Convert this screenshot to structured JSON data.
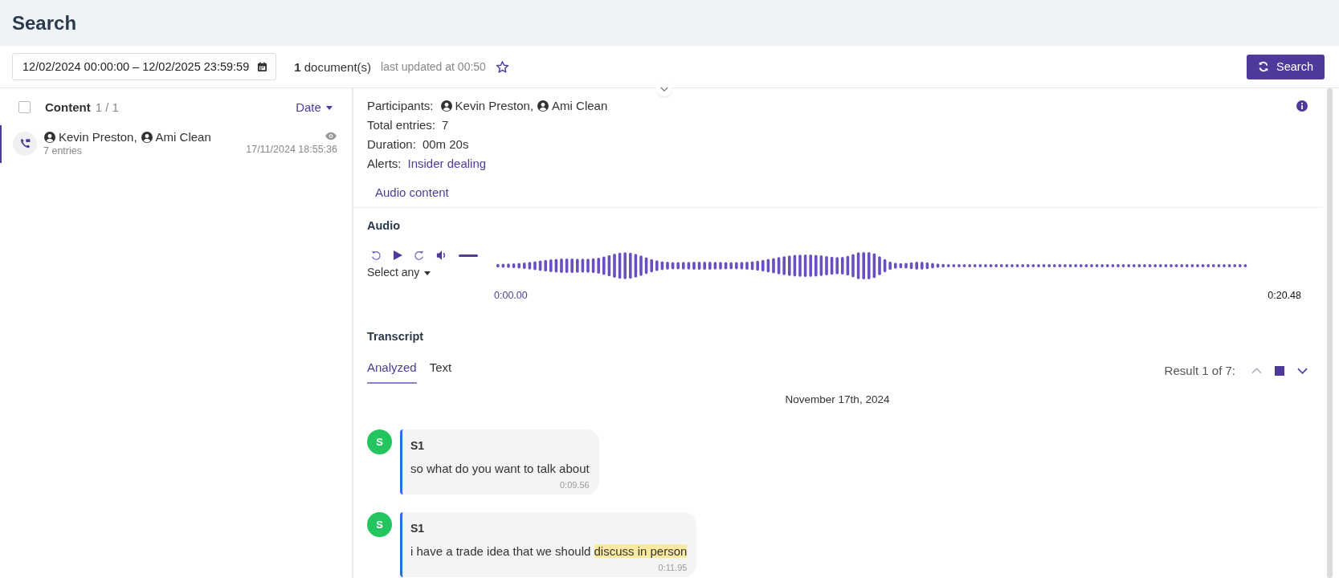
{
  "page_title": "Search",
  "toolbar": {
    "date_range": "12/02/2024 00:00:00 – 12/02/2025 23:59:59",
    "document_count": "1",
    "document_label": "document(s)",
    "last_updated": "last updated at 00:50",
    "favorite": false,
    "search_button": "Search"
  },
  "list": {
    "header": {
      "title": "Content",
      "count": "1 / 1",
      "select_all": false,
      "sort": "Date"
    },
    "items": [
      {
        "participants": [
          "Kevin Preston,",
          "Ami Clean"
        ],
        "entries": "7 entries",
        "date": "17/11/2024 18:55:36",
        "selected": true
      }
    ]
  },
  "detail": {
    "fields": [
      {
        "label": "Participants:",
        "kind": "people",
        "people": [
          "Kevin Preston,",
          "Ami Clean"
        ]
      },
      {
        "label": "Total entries:",
        "kind": "text",
        "value": "7"
      },
      {
        "label": "Duration:",
        "kind": "text",
        "value": "00m 20s"
      },
      {
        "label": "Alerts:",
        "kind": "link",
        "value": "Insider dealing"
      }
    ],
    "content_link": "Audio content",
    "audio": {
      "title": "Audio",
      "speed": "Select any",
      "volume": {
        "level": 1
      },
      "start_time": "0:00.00",
      "end_time": "0:20.48"
    },
    "transcript": {
      "title": "Transcript",
      "tabs": [
        {
          "label": "Analyzed",
          "selected": true
        },
        {
          "label": "Text",
          "selected": false
        }
      ],
      "result": "Result 1 of 7:",
      "date": "November 17th, 2024",
      "messages": [
        {
          "initial": "S",
          "color": "#22c55e",
          "speaker": "S1",
          "parts": [
            {
              "text": "so what do you want to talk about",
              "highlighted": false
            }
          ],
          "time": "0:09.56"
        },
        {
          "initial": "S",
          "color": "#22c55e",
          "speaker": "S1",
          "parts": [
            {
              "text": "i have a trade idea that we should ",
              "highlighted": false
            },
            {
              "text": "discuss in person",
              "highlighted": true
            }
          ],
          "time": "0:11.95"
        }
      ]
    }
  }
}
